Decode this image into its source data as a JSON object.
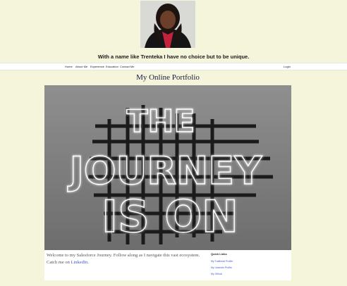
{
  "tagline": "With a name like Trenteka I have no choice but to be unique.",
  "nav": {
    "home": "Home",
    "about": "About Me",
    "experience": "Experience",
    "education": "Education",
    "contact": "Contact Me",
    "login": "Login"
  },
  "page_title": "My Online Portfolio",
  "hero": {
    "neon_lines": [
      "THE",
      "JOURNEY",
      "IS ON"
    ]
  },
  "intro": {
    "text_before_link": "Welcome to my Salesforce Journey. Follow along as I navigate this vast ecosystem. Catch me on ",
    "link_label": "LinkedIn",
    "text_after_link": "."
  },
  "quick_links": {
    "title": "Quick Links",
    "items": [
      "My Trailhead Profile",
      "My LinkedIn Profile",
      "My Github"
    ]
  }
}
